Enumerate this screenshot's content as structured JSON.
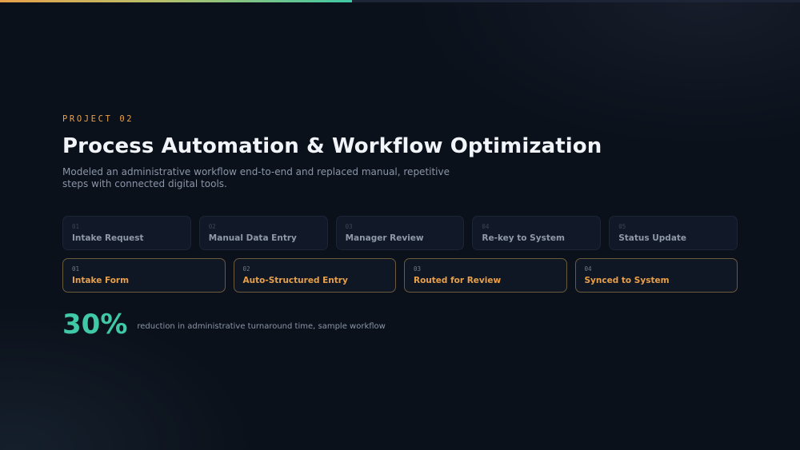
{
  "slide": {
    "progress": 0.44,
    "eyebrow": "PROJECT 02",
    "title": "Process Automation & Workflow Optimization",
    "subtitle": "Modeled an administrative workflow end-to-end and replaced manual, repetitive steps with connected digital tools."
  },
  "workflow_before": [
    {
      "num": "01",
      "label": "Intake Request"
    },
    {
      "num": "02",
      "label": "Manual Data Entry"
    },
    {
      "num": "03",
      "label": "Manager Review"
    },
    {
      "num": "04",
      "label": "Re-key to System"
    },
    {
      "num": "05",
      "label": "Status Update"
    }
  ],
  "workflow_after": [
    {
      "num": "01",
      "label": "Intake Form"
    },
    {
      "num": "02",
      "label": "Auto-Structured Entry"
    },
    {
      "num": "03",
      "label": "Routed for Review"
    },
    {
      "num": "04",
      "label": "Synced to System"
    }
  ],
  "metric": {
    "value": "30%",
    "caption": "reduction in administrative turnaround time, sample workflow"
  },
  "colors": {
    "background": "#0b111b",
    "accent_orange": "#e8a04a",
    "accent_green": "#3fc9a4",
    "title": "#f1f4f8",
    "muted_text": "#8a95a8"
  }
}
